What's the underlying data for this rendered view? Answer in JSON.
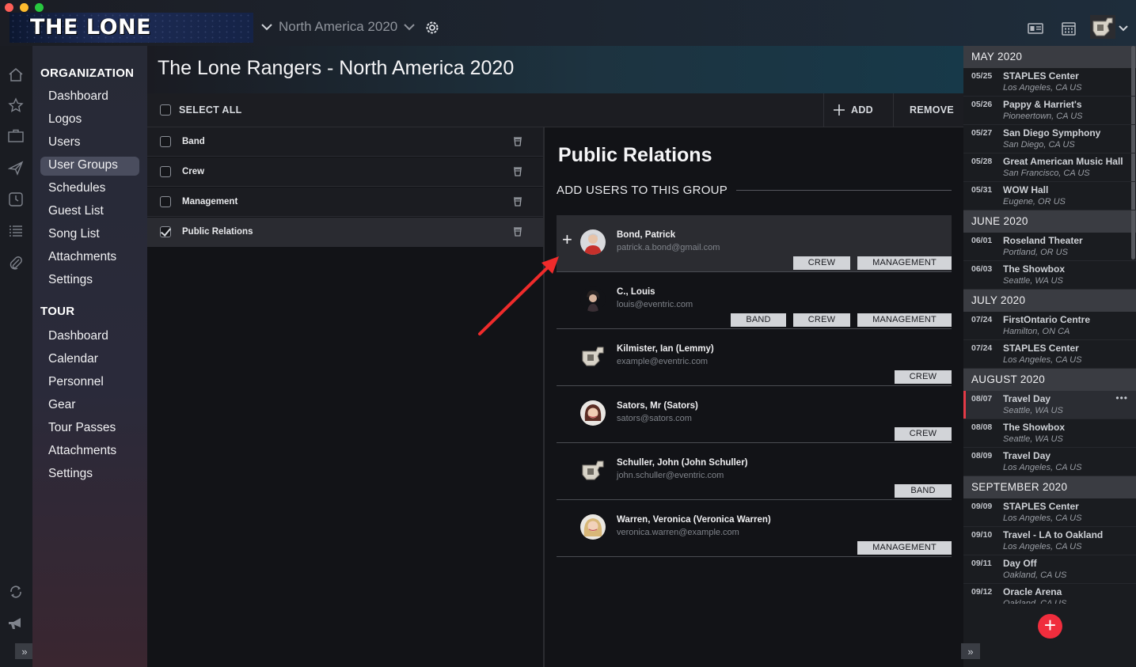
{
  "topbar": {
    "logo_text": "THE LONE RANGERS",
    "tour_name": "North America 2020",
    "window_controls": {
      "close": "#fe5f57",
      "minimize": "#febc2e",
      "zoom": "#28c840"
    }
  },
  "nav": {
    "organization_label": "ORGANIZATION",
    "organization_items": [
      "Dashboard",
      "Logos",
      "Users",
      "User Groups",
      "Schedules",
      "Guest List",
      "Song List",
      "Attachments",
      "Settings"
    ],
    "tour_label": "TOUR",
    "tour_items": [
      "Dashboard",
      "Calendar",
      "Personnel",
      "Gear",
      "Tour Passes",
      "Attachments",
      "Settings"
    ]
  },
  "page": {
    "title": "The Lone Rangers - North America 2020"
  },
  "toolbar": {
    "select_all": "SELECT ALL",
    "add": "ADD",
    "remove": "REMOVE"
  },
  "groups": [
    {
      "name": "Band",
      "checked": false
    },
    {
      "name": "Crew",
      "checked": false
    },
    {
      "name": "Management",
      "checked": false
    },
    {
      "name": "Public Relations",
      "checked": true
    }
  ],
  "detail": {
    "title": "Public Relations",
    "subtitle": "ADD USERS TO THIS GROUP",
    "users": [
      {
        "name": "Bond, Patrick",
        "email": "patrick.a.bond@gmail.com",
        "tags": [
          "CREW",
          "MANAGEMENT"
        ],
        "avatar": "red-shirt-person"
      },
      {
        "name": "C., Louis",
        "email": "louis@eventric.com",
        "tags": [
          "BAND",
          "CREW",
          "MANAGEMENT"
        ],
        "avatar": "dark-hair-person"
      },
      {
        "name": "Kilmister, Ian (Lemmy)",
        "email": "example@eventric.com",
        "tags": [
          "CREW"
        ],
        "avatar": "guitar"
      },
      {
        "name": "Sators, Mr (Sators)",
        "email": "sators@sators.com",
        "tags": [
          "CREW"
        ],
        "avatar": "woman"
      },
      {
        "name": "Schuller, John (John Schuller)",
        "email": "john.schuller@eventric.com",
        "tags": [
          "BAND"
        ],
        "avatar": "guitar"
      },
      {
        "name": "Warren, Veronica (Veronica Warren)",
        "email": "veronica.warren@example.com",
        "tags": [
          "MANAGEMENT"
        ],
        "avatar": "blonde-woman"
      }
    ]
  },
  "schedule": {
    "months": [
      {
        "label": "MAY 2020",
        "events": [
          {
            "date": "05/25",
            "title": "STAPLES Center",
            "location": "Los Angeles, CA US"
          },
          {
            "date": "05/26",
            "title": "Pappy & Harriet's",
            "location": "Pioneertown, CA US"
          },
          {
            "date": "05/27",
            "title": "San Diego Symphony",
            "location": "San Diego, CA US"
          },
          {
            "date": "05/28",
            "title": "Great American Music Hall",
            "location": "San Francisco, CA US"
          },
          {
            "date": "05/31",
            "title": "WOW Hall",
            "location": "Eugene, OR US"
          }
        ]
      },
      {
        "label": "JUNE 2020",
        "events": [
          {
            "date": "06/01",
            "title": "Roseland Theater",
            "location": "Portland, OR US"
          },
          {
            "date": "06/03",
            "title": "The Showbox",
            "location": "Seattle, WA US"
          }
        ]
      },
      {
        "label": "JULY 2020",
        "events": [
          {
            "date": "07/24",
            "title": "FirstOntario Centre",
            "location": "Hamilton, ON CA"
          },
          {
            "date": "07/24",
            "title": "STAPLES Center",
            "location": "Los Angeles, CA US"
          }
        ]
      },
      {
        "label": "AUGUST 2020",
        "events": [
          {
            "date": "08/07",
            "title": "Travel Day",
            "location": "Seattle, WA US",
            "highlight": true,
            "more": "•••"
          },
          {
            "date": "08/08",
            "title": "The Showbox",
            "location": "Seattle, WA US"
          },
          {
            "date": "08/09",
            "title": "Travel Day",
            "location": "Los Angeles, CA US"
          }
        ]
      },
      {
        "label": "SEPTEMBER 2020",
        "events": [
          {
            "date": "09/09",
            "title": "STAPLES Center",
            "location": "Los Angeles, CA US"
          },
          {
            "date": "09/10",
            "title": "Travel - LA to Oakland",
            "location": "Los Angeles, CA US"
          },
          {
            "date": "09/11",
            "title": "Day Off",
            "location": "Oakland, CA US"
          },
          {
            "date": "09/12",
            "title": "Oracle Arena",
            "location": "Oakland, CA US"
          }
        ]
      }
    ]
  },
  "colors": {
    "accent_red": "#f02d3d",
    "highlight_bar": "#e23a47",
    "tag_bg": "#d2d4d8"
  }
}
